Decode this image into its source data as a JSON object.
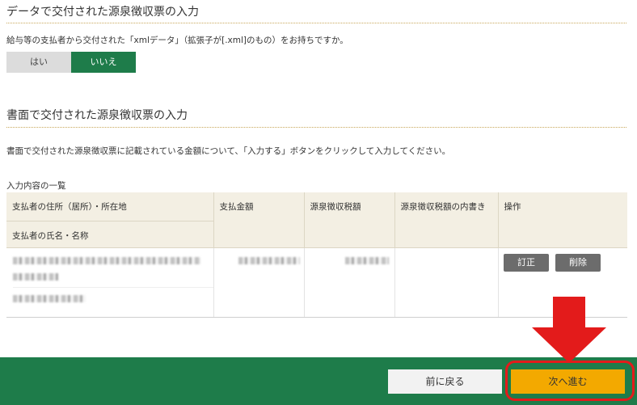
{
  "section1": {
    "title": "データで交付された源泉徴収票の入力",
    "question": "給与等の支払者から交付された「xmlデータ」（拡張子が[.xml]のもの）をお持ちですか。",
    "yes_label": "はい",
    "no_label": "いいえ"
  },
  "section2": {
    "title": "書面で交付された源泉徴収票の入力",
    "description": "書面で交付された源泉徴収票に記載されている金額について、「入力する」ボタンをクリックして入力してください。"
  },
  "table": {
    "caption": "入力内容の一覧",
    "headers": {
      "payer_address": "支払者の住所（居所）・所在地",
      "payer_name": "支払者の氏名・名称",
      "payment_amount": "支払金額",
      "withholding_tax": "源泉徴収税額",
      "withholding_breakdown": "源泉徴収税額の内書き",
      "operations": "操作"
    },
    "row": {
      "edit_label": "訂正",
      "delete_label": "削除"
    }
  },
  "footer": {
    "back_label": "前に戻る",
    "next_label": "次へ進む"
  },
  "colors": {
    "brand_green": "#1e7c4a",
    "next_orange": "#f3a900",
    "highlight_red": "#e31b1b"
  }
}
